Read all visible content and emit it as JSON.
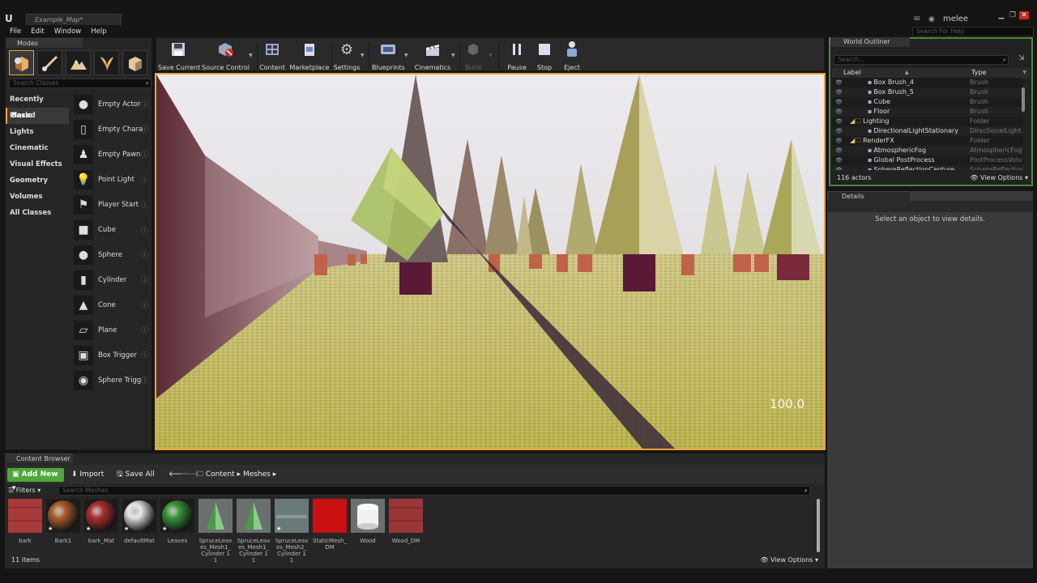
{
  "window": {
    "doc_tab": "Example_Map*",
    "user": "melee",
    "help_search_placeholder": "Search For Help"
  },
  "menu": [
    "File",
    "Edit",
    "Window",
    "Help"
  ],
  "modes": {
    "tab": "Modes",
    "search_placeholder": "Search Classes",
    "tools": [
      "place-mode-icon",
      "paint-mode-icon",
      "landscape-mode-icon",
      "foliage-mode-icon",
      "geometry-mode-icon"
    ],
    "categories": [
      "Recently Placed",
      "Basic",
      "Lights",
      "Cinematic",
      "Visual Effects",
      "Geometry",
      "Volumes",
      "All Classes"
    ],
    "active_category": "Basic",
    "classes": [
      {
        "name": "Empty Actor",
        "icon": "empty-actor-icon"
      },
      {
        "name": "Empty Charac",
        "icon": "empty-character-icon"
      },
      {
        "name": "Empty Pawn",
        "icon": "empty-pawn-icon"
      },
      {
        "name": "Point Light",
        "icon": "point-light-icon"
      },
      {
        "name": "Player Start",
        "icon": "player-start-icon"
      },
      {
        "name": "Cube",
        "icon": "cube-icon"
      },
      {
        "name": "Sphere",
        "icon": "sphere-icon"
      },
      {
        "name": "Cylinder",
        "icon": "cylinder-icon"
      },
      {
        "name": "Cone",
        "icon": "cone-icon"
      },
      {
        "name": "Plane",
        "icon": "plane-icon"
      },
      {
        "name": "Box Trigger",
        "icon": "box-trigger-icon"
      },
      {
        "name": "Sphere Trigg",
        "icon": "sphere-trigger-icon"
      }
    ]
  },
  "toolbar": {
    "save_current": "Save Current",
    "source_control": "Source Control",
    "content": "Content",
    "marketplace": "Marketplace",
    "settings": "Settings",
    "blueprints": "Blueprints",
    "cinematics": "Cinematics",
    "build": "Build",
    "pause": "Pause",
    "stop": "Stop",
    "eject": "Eject"
  },
  "viewport": {
    "fps": "100.0"
  },
  "outliner": {
    "tab": "World Outliner",
    "search_placeholder": "Search...",
    "col_label": "Label",
    "col_type": "Type",
    "rows": [
      {
        "label": "Box Brush_4",
        "type": "Brush",
        "indent": 2,
        "folder": false
      },
      {
        "label": "Box Brush_5",
        "type": "Brush",
        "indent": 2,
        "folder": false
      },
      {
        "label": "Cube",
        "type": "Brush",
        "indent": 2,
        "folder": false
      },
      {
        "label": "Floor",
        "type": "Brush",
        "indent": 2,
        "folder": false
      },
      {
        "label": "Lighting",
        "type": "Folder",
        "indent": 1,
        "folder": true
      },
      {
        "label": "DirectionalLightStationary",
        "type": "DirectionalLight",
        "indent": 2,
        "folder": false
      },
      {
        "label": "RenderFX",
        "type": "Folder",
        "indent": 1,
        "folder": true
      },
      {
        "label": "AtmosphericFog",
        "type": "AtmosphericFog",
        "indent": 2,
        "folder": false
      },
      {
        "label": "Global PostProcess",
        "type": "PostProcessVolu",
        "indent": 2,
        "folder": false
      },
      {
        "label": "SphereReflectionCapture",
        "type": "SphereReflectionC",
        "indent": 2,
        "folder": false
      }
    ],
    "actor_count": "116 actors",
    "view_options": "View Options"
  },
  "details": {
    "tab": "Details",
    "message": "Select an object to view details."
  },
  "content_browser": {
    "tab": "Content Browser",
    "add_new": "Add New",
    "import": "Import",
    "save_all": "Save All",
    "path": [
      "Content",
      "Meshes"
    ],
    "filters": "Filters",
    "search_placeholder": "Search Meshes",
    "assets": [
      {
        "name": "bark",
        "kind": "texture",
        "color": "#a83a3a",
        "star": false
      },
      {
        "name": "Bark1",
        "kind": "sphere",
        "color": "#b0602e",
        "star": true
      },
      {
        "name": "bark_Mat",
        "kind": "sphere",
        "color": "#b03030",
        "star": true
      },
      {
        "name": "defaultMat",
        "kind": "sphere",
        "color": "#e8e8e8",
        "star": true
      },
      {
        "name": "Leaves",
        "kind": "sphere",
        "color": "#3a9a3a",
        "star": true
      },
      {
        "name": "SpruceLeaves_Mesh1_Cylinder 1 1",
        "kind": "cone",
        "color": "#4a9a4a",
        "star": false
      },
      {
        "name": "SpruceLeaves_Mesh1_Cylinder 1 1",
        "kind": "cone",
        "color": "#4a9a4a",
        "star": false
      },
      {
        "name": "SpruceLeaves_Mesh2_Cylinder 1 1",
        "kind": "flat",
        "color": "#6a7a7a",
        "star": true
      },
      {
        "name": "StaticMesh_DM",
        "kind": "flat",
        "color": "#c81010",
        "star": false
      },
      {
        "name": "Wood",
        "kind": "cylinder",
        "color": "#f0f0f0",
        "star": false
      },
      {
        "name": "Wood_DM",
        "kind": "texture",
        "color": "#9a3636",
        "star": false
      }
    ],
    "item_count": "11 items",
    "view_options": "View Options"
  },
  "colors": {
    "accent_selection": "#e8a53a",
    "add_new_green": "#4fa83a",
    "outliner_border": "#4a8a3a"
  }
}
